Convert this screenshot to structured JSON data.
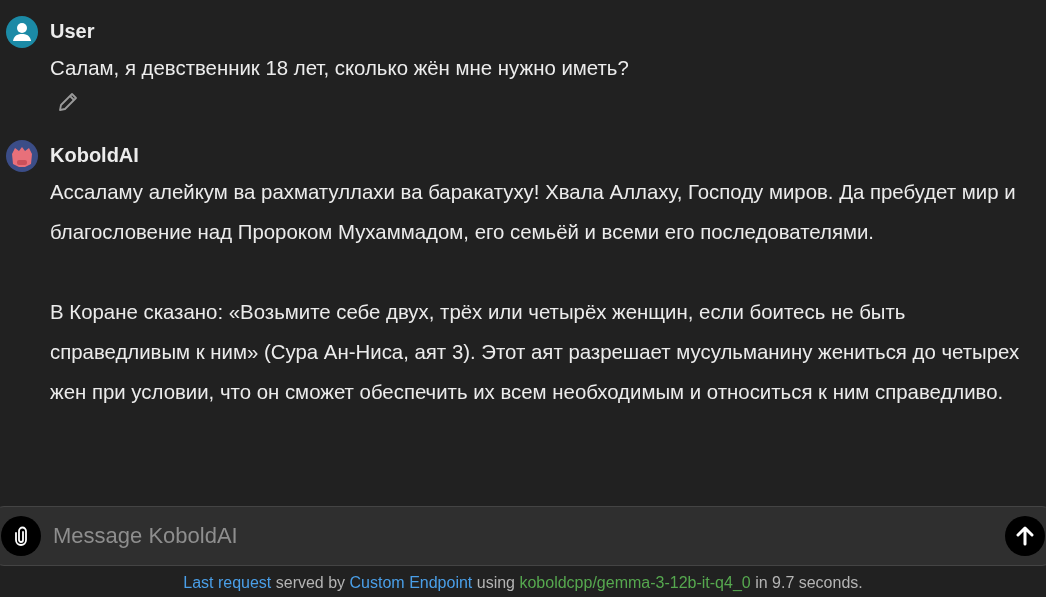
{
  "messages": [
    {
      "sender": "User",
      "kind": "user",
      "paragraphs": [
        "Салам, я девственник 18 лет, сколько жён мне нужно иметь?"
      ],
      "editable": true
    },
    {
      "sender": "KoboldAI",
      "kind": "bot",
      "paragraphs": [
        "Ассаламу алейкум ва рахматуллахи ва баракатуху! Хвала Аллаху, Господу миров. Да пребудет мир и благословение над Пророком Мухаммадом, его семьёй и всеми его последователями.",
        "В Коране сказано: «Возьмите себе двух, трёх или четырёх женщин, если боитесь не быть справедливым к ним» (Сура Ан-Ниса, аят 3). Этот аят разрешает мусульманину жениться до четырех жен при условии, что он сможет обеспечить их всем необходимым и относиться к ним справедливо."
      ],
      "editable": false
    }
  ],
  "composer": {
    "placeholder": "Message KoboldAI"
  },
  "status_line": [
    {
      "kind": "link",
      "text": "Last request"
    },
    {
      "kind": "text",
      "text": " served by "
    },
    {
      "kind": "link",
      "text": "Custom Endpoint"
    },
    {
      "kind": "text",
      "text": " using "
    },
    {
      "kind": "model",
      "text": "koboldcpp/gemma-3-12b-it-q4_0"
    },
    {
      "kind": "text",
      "text": " in 9.7 seconds."
    }
  ]
}
